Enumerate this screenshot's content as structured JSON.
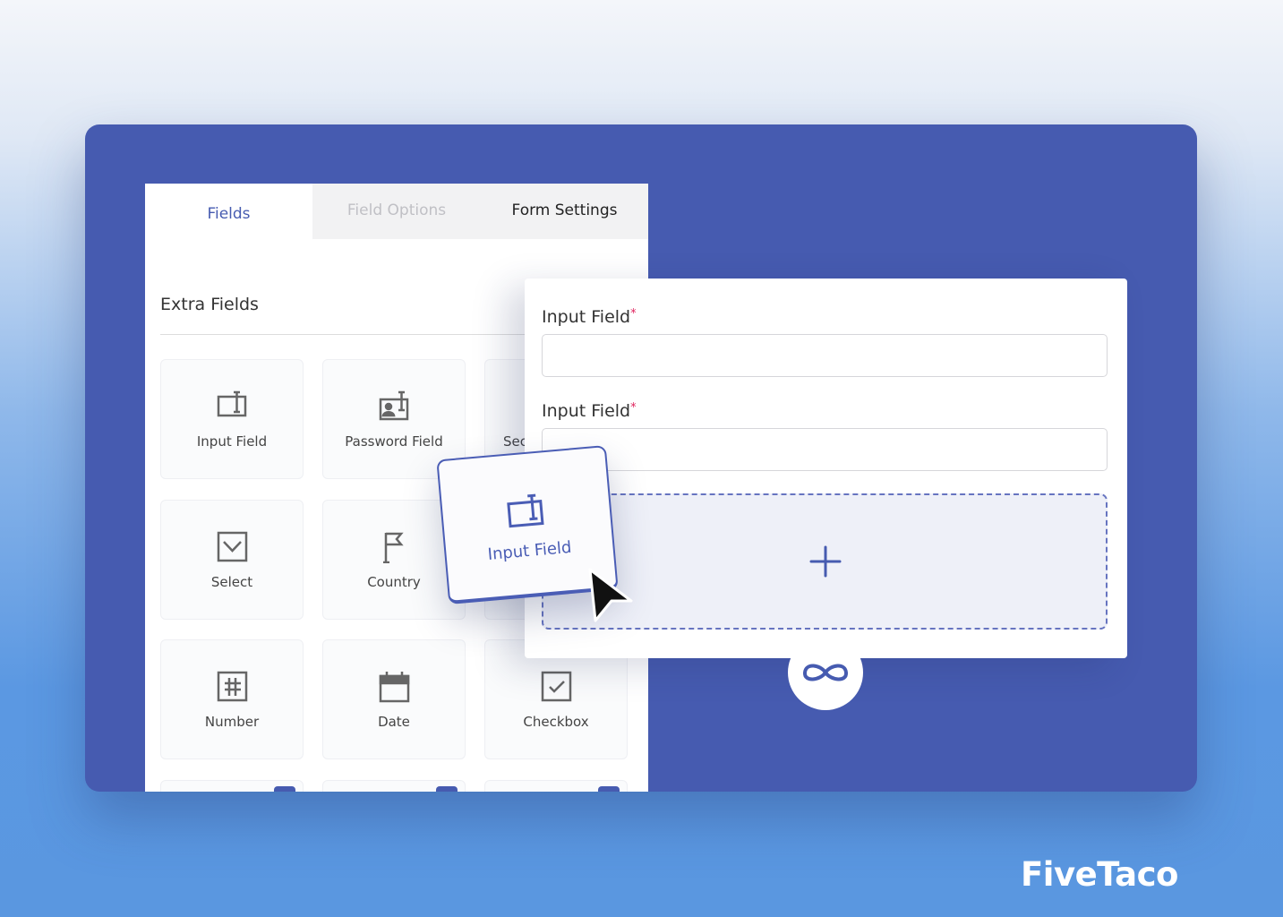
{
  "tabs": [
    {
      "label": "Fields",
      "active": true
    },
    {
      "label": "Field Options"
    },
    {
      "label": "Form Settings"
    }
  ],
  "section_title": "Extra Fields",
  "tiles": [
    {
      "label": "Input Field",
      "icon": "input-field-icon"
    },
    {
      "label": "Password Field",
      "icon": "password-field-icon"
    },
    {
      "label": "Sec",
      "icon": ""
    },
    {
      "label": "Select",
      "icon": "select-icon"
    },
    {
      "label": "Country",
      "icon": "flag-icon"
    },
    {
      "label": "",
      "icon": ""
    },
    {
      "label": "Number",
      "icon": "number-icon"
    },
    {
      "label": "Date",
      "icon": "calendar-icon"
    },
    {
      "label": "Checkbox",
      "icon": "checkbox-icon"
    }
  ],
  "form": {
    "fields": [
      {
        "label": "Input Field",
        "required": "*"
      },
      {
        "label": "Input Field",
        "required": "*"
      }
    ]
  },
  "drag_card": {
    "label": "Input Field",
    "icon": "input-field-icon"
  },
  "brand": "FiveTaco",
  "colors": {
    "accent": "#465bb0",
    "required": "#e0245e"
  }
}
